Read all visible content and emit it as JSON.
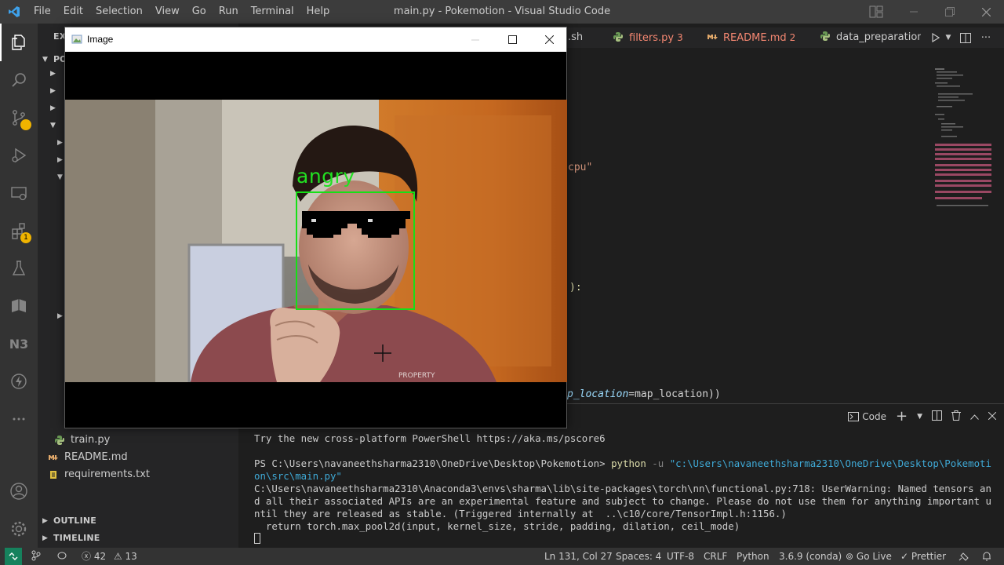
{
  "titlebar": {
    "menu": [
      "File",
      "Edit",
      "Selection",
      "View",
      "Go",
      "Run",
      "Terminal",
      "Help"
    ],
    "window_title": "main.py - Pokemotion - Visual Studio Code"
  },
  "activity_bar": {
    "icons": [
      "explorer-icon",
      "search-icon",
      "source-control-icon",
      "run-debug-icon",
      "remote-explorer-icon",
      "extensions-icon",
      "testing-icon",
      "book-icon",
      "n3-icon",
      "thunder-icon",
      "more-icon",
      "account-icon",
      "settings-gear-icon"
    ],
    "extensions_badge": "1",
    "n3_label": "N3"
  },
  "sidebar": {
    "explorer_label": "EX",
    "root_folder": "PO",
    "files": [
      {
        "name": "train.py",
        "icon": "python-icon"
      },
      {
        "name": "README.md",
        "icon": "markdown-icon"
      },
      {
        "name": "requirements.txt",
        "icon": "text-file-icon"
      }
    ],
    "outline_label": "OUTLINE",
    "timeline_label": "TIMELINE"
  },
  "tabs": [
    {
      "label": ".sh",
      "color": "#cccccc"
    },
    {
      "label": "filters.py",
      "count": "3",
      "color": "#f48771"
    },
    {
      "label": "README.md",
      "count": "2",
      "color": "#f48771"
    },
    {
      "label": "data_preparation.py",
      "color": "#cccccc"
    }
  ],
  "editor": {
    "fragments": [
      {
        "text": "cpu\""
      },
      {
        "text": "):"
      },
      {
        "text": "p_location=map_location))"
      }
    ]
  },
  "panel": {
    "terminal_kind": "Code",
    "lines": [
      "Try the new cross-platform PowerShell https://aka.ms/pscore6",
      "",
      "PS C:\\Users\\navaneethsharma2310\\OneDrive\\Desktop\\Pokemotion> python -u \"c:\\Users\\navaneethsharma2310\\OneDrive\\Desktop\\Pokemotion\\src\\main.py\"",
      "C:\\Users\\navaneethsharma2310\\Anaconda3\\envs\\sharma\\lib\\site-packages\\torch\\nn\\functional.py:718: UserWarning: Named tensors and all their associated APIs are an experimental feature and subject to change. Please do not use them for anything important until they are released as stable. (Triggered internally at  ..\\c10/core/TensorImpl.h:1156.)",
      "  return torch.max_pool2d(input, kernel_size, stride, padding, dilation, ceil_mode)"
    ]
  },
  "statusbar": {
    "errors": "42",
    "warnings": "13",
    "position": "Ln 131, Col 27",
    "spaces": "Spaces: 4",
    "encoding": "UTF-8",
    "eol": "CRLF",
    "language": "Python",
    "interpreter": "3.6.9 (conda)",
    "go_live": "Go Live",
    "prettier": "Prettier"
  },
  "image_window": {
    "title": "Image",
    "emotion": "angry"
  },
  "colors": {
    "accent_green": "#16e016",
    "titlebar": "#3c3c3c",
    "activity_bar": "#333333",
    "sidebar": "#252526",
    "editor": "#1e1e1e"
  }
}
